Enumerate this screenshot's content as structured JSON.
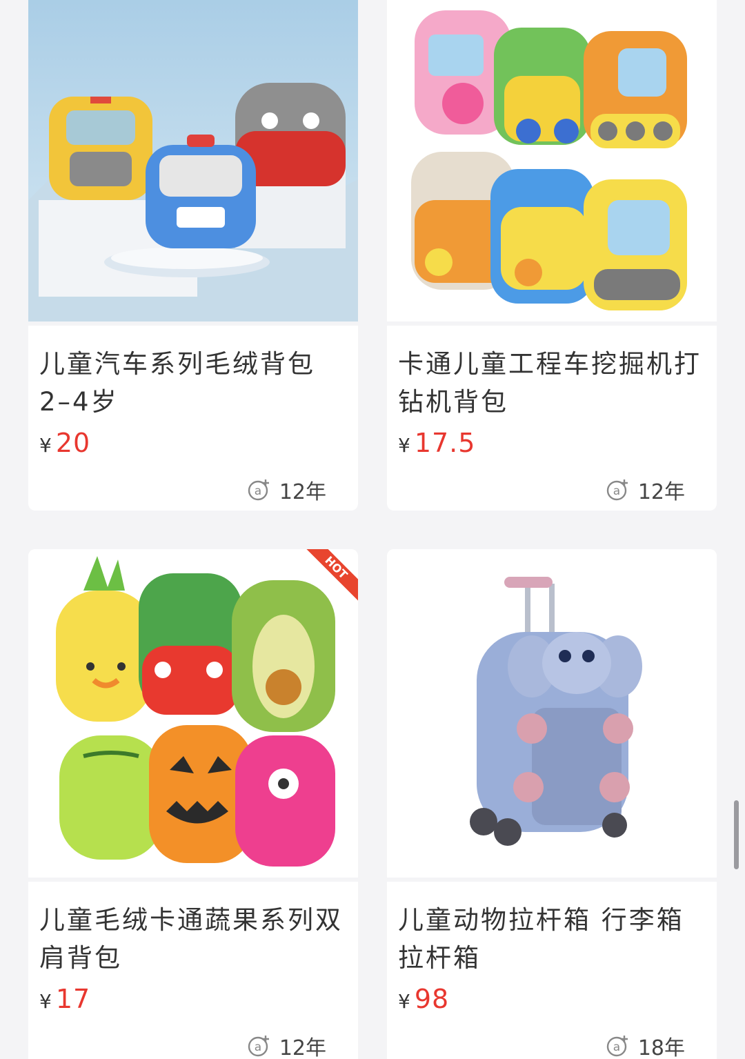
{
  "products": [
    {
      "title": "儿童汽车系列毛绒背包2–4岁",
      "currency": "¥",
      "price": "20",
      "age": "12年",
      "image_alt": "plush car backpacks",
      "badge": ""
    },
    {
      "title": "卡通儿童工程车挖掘机打钻机背包",
      "currency": "¥",
      "price": "17.5",
      "age": "12年",
      "image_alt": "construction vehicle backpacks",
      "badge": ""
    },
    {
      "title": "儿童毛绒卡通蔬果系列双肩背包",
      "currency": "¥",
      "price": "17",
      "age": "12年",
      "image_alt": "fruit and vegetable plush backpacks",
      "badge": "HOT"
    },
    {
      "title": "儿童动物拉杆箱 行李箱拉杆箱",
      "currency": "¥",
      "price": "98",
      "age": "18年",
      "image_alt": "elephant trolley suitcase",
      "badge": ""
    }
  ],
  "icons": {
    "meta": "at-plus-icon"
  },
  "colors": {
    "price": "#e8372f",
    "background": "#f4f4f6",
    "hot": "#e8452e"
  }
}
